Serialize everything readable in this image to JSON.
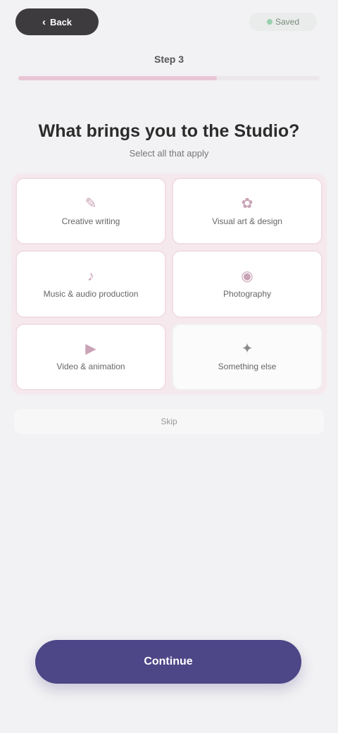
{
  "header": {
    "back_label": "Back",
    "back_icon": "chevron-left-icon",
    "status_label": "Saved",
    "step_label": "Step 3"
  },
  "progress": {
    "fraction": 0.66,
    "fill_color": "#e8c6d5"
  },
  "main": {
    "title": "What brings you to the Studio?",
    "subtitle": "Select all that apply"
  },
  "options": [
    {
      "label": "Creative writing",
      "icon": "pen-icon",
      "selected": true
    },
    {
      "label": "Visual art & design",
      "icon": "palette-icon",
      "selected": true
    },
    {
      "label": "Music & audio production",
      "icon": "music-icon",
      "selected": true
    },
    {
      "label": "Photography",
      "icon": "camera-icon",
      "selected": true
    },
    {
      "label": "Video & animation",
      "icon": "film-icon",
      "selected": true
    },
    {
      "label": "Something else",
      "icon": "sparkle-icon",
      "selected": false
    }
  ],
  "skip_label": "Skip",
  "continue_label": "Continue",
  "colors": {
    "accent": "#4d4687",
    "selected_tint": "#f6e9ee"
  }
}
